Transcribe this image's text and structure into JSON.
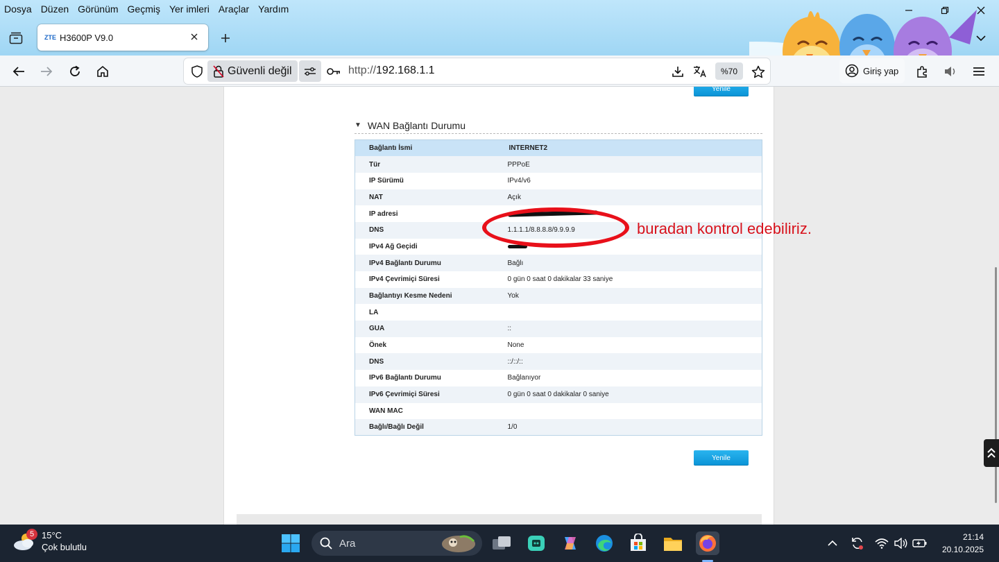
{
  "menubar": {
    "items": [
      {
        "label": "Dosya"
      },
      {
        "label": "Düzen"
      },
      {
        "label": "Görünüm"
      },
      {
        "label": "Geçmiş"
      },
      {
        "label": "Yer imleri"
      },
      {
        "label": "Araçlar"
      },
      {
        "label": "Yardım"
      }
    ]
  },
  "tab": {
    "favicon_text": "ZTE",
    "title": "H3600P V9.0"
  },
  "toolbar": {
    "security_label": "Güvenli değil",
    "url_scheme": "http://",
    "url_host": "192.168.1.1",
    "zoom_label": "%70",
    "signin_label": "Giriş yap"
  },
  "page": {
    "refresh_label": "Yenile",
    "section_title": "WAN Bağlantı Durumu",
    "rows": [
      {
        "label": "Bağlantı İsmi",
        "value": "INTERNET2"
      },
      {
        "label": "Tür",
        "value": "PPPoE"
      },
      {
        "label": "IP Sürümü",
        "value": "IPv4/v6"
      },
      {
        "label": "NAT",
        "value": "Açık"
      },
      {
        "label": "IP adresi",
        "value": ""
      },
      {
        "label": "DNS",
        "value": "1.1.1.1/8.8.8.8/9.9.9.9"
      },
      {
        "label": "IPv4 Ağ Geçidi",
        "value": ""
      },
      {
        "label": "IPv4 Bağlantı Durumu",
        "value": "Bağlı"
      },
      {
        "label": "IPv4 Çevrimiçi Süresi",
        "value": "0 gün 0 saat 0 dakikalar 33 saniye"
      },
      {
        "label": "Bağlantıyı Kesme Nedeni",
        "value": "Yok"
      },
      {
        "label": "LA",
        "value": ""
      },
      {
        "label": "GUA",
        "value": "::"
      },
      {
        "label": "Önek",
        "value": "None"
      },
      {
        "label": "DNS",
        "value": "::/::/::"
      },
      {
        "label": "IPv6 Bağlantı Durumu",
        "value": "Bağlanıyor"
      },
      {
        "label": "IPv6 Çevrimiçi Süresi",
        "value": "0 gün 0 saat 0 dakikalar 0 saniye"
      },
      {
        "label": "WAN MAC",
        "value": ""
      },
      {
        "label": "Bağlı/Bağlı Değil",
        "value": "1/0"
      }
    ]
  },
  "annotation": {
    "text": "buradan kontrol edebiliriz.",
    "color": "#e8101a"
  },
  "taskbar": {
    "weather_badge": "5",
    "weather_temp": "15°C",
    "weather_desc": "Çok bulutlu",
    "search_placeholder": "Ara",
    "time": "21:14",
    "date": "20.10.2025"
  },
  "colors": {
    "accent_blue": "#0a93d6",
    "table_header": "#c9e3f7",
    "taskbar_bg": "#1b2431"
  }
}
